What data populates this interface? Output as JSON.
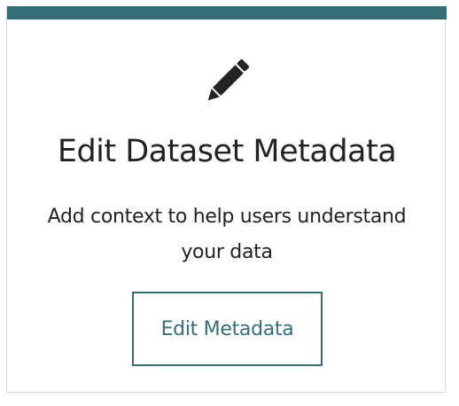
{
  "card": {
    "title": "Edit Dataset Metadata",
    "description": "Add context to help users understand your data",
    "button_label": "Edit Metadata",
    "icon": "pencil-icon"
  },
  "colors": {
    "accent": "#346f77",
    "text": "#222222",
    "border": "#d9d9d9"
  }
}
